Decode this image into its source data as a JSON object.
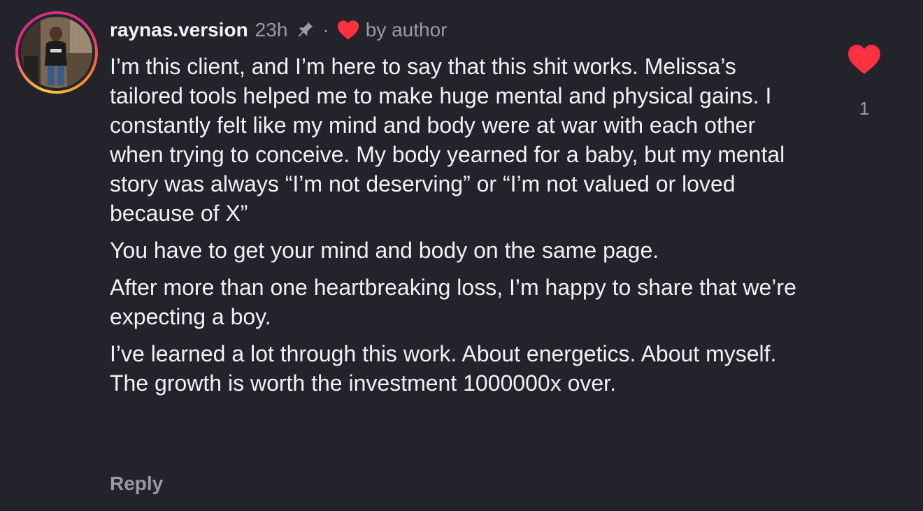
{
  "comment": {
    "username": "raynas.version",
    "time": "23h",
    "separator": "·",
    "liked_by_author_label": "by author",
    "paragraphs": [
      "I’m this client, and I’m here to say that this shit works. Melissa’s tailored tools helped me to make huge mental and physical gains. I constantly felt like my mind and body were at war with each other when trying to conceive. My body yearned for a baby, but my mental story was always “I’m not deserving” or “I’m not valued or loved because of X”",
      "You have to get your mind and body on the same page.",
      "After more than one heartbreaking loss, I’m happy to share that we’re expecting a boy.",
      "I’ve learned a lot through this work. About energetics. About myself. The growth is worth the investment 1000000x over."
    ],
    "reply_label": "Reply",
    "like_count": "1"
  },
  "icons": {
    "pin": "pin-icon",
    "author_heart": "heart-icon",
    "like": "heart-filled-icon"
  },
  "colors": {
    "background": "#23232b",
    "text": "#f2f2f4",
    "muted": "#9a9aa2",
    "heart": "#ff3040"
  }
}
